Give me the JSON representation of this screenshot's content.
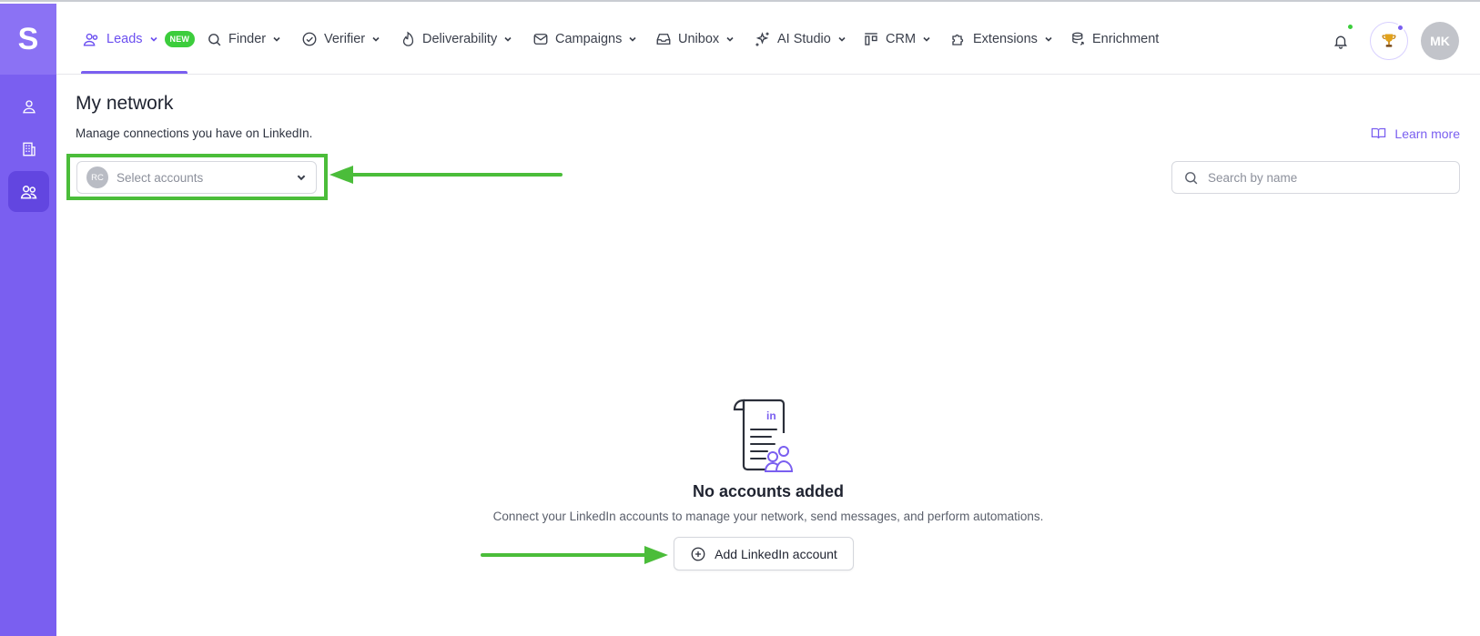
{
  "sidebar": {
    "logo": "S",
    "items": [
      {
        "icon": "person-icon"
      },
      {
        "icon": "building-icon"
      },
      {
        "icon": "people-icon",
        "active": true
      }
    ]
  },
  "nav": {
    "items": [
      {
        "label": "Leads",
        "icon": "people-icon",
        "badge": "NEW",
        "active": true
      },
      {
        "label": "Finder",
        "icon": "search-icon"
      },
      {
        "label": "Verifier",
        "icon": "check-circle-icon"
      },
      {
        "label": "Deliverability",
        "icon": "flame-icon"
      },
      {
        "label": "Campaigns",
        "icon": "mail-icon"
      },
      {
        "label": "Unibox",
        "icon": "inbox-icon"
      },
      {
        "label": "AI Studio",
        "icon": "sparkle-icon"
      },
      {
        "label": "CRM",
        "icon": "columns-icon"
      },
      {
        "label": "Extensions",
        "icon": "puzzle-icon"
      },
      {
        "label": "Enrichment",
        "icon": "database-icon"
      }
    ],
    "avatar_initials": "MK",
    "colors": {
      "accent": "#7a5ff0",
      "new_badge": "#3ccd3c",
      "notification_dot": "#3ccd3c",
      "trophy_dot": "#7a5ff0"
    }
  },
  "main": {
    "title": "My network",
    "subtitle": "Manage connections you have on LinkedIn.",
    "learn_more": "Learn more",
    "select_accounts": {
      "avatar_initials": "RC",
      "placeholder": "Select accounts"
    },
    "search": {
      "placeholder": "Search by name"
    },
    "empty": {
      "title": "No accounts added",
      "description": "Connect your LinkedIn accounts to manage your network, send messages, and perform automations.",
      "button": "Add LinkedIn account",
      "illustration_label": "in"
    }
  },
  "annotations": {
    "color": "#4bbd3a"
  }
}
